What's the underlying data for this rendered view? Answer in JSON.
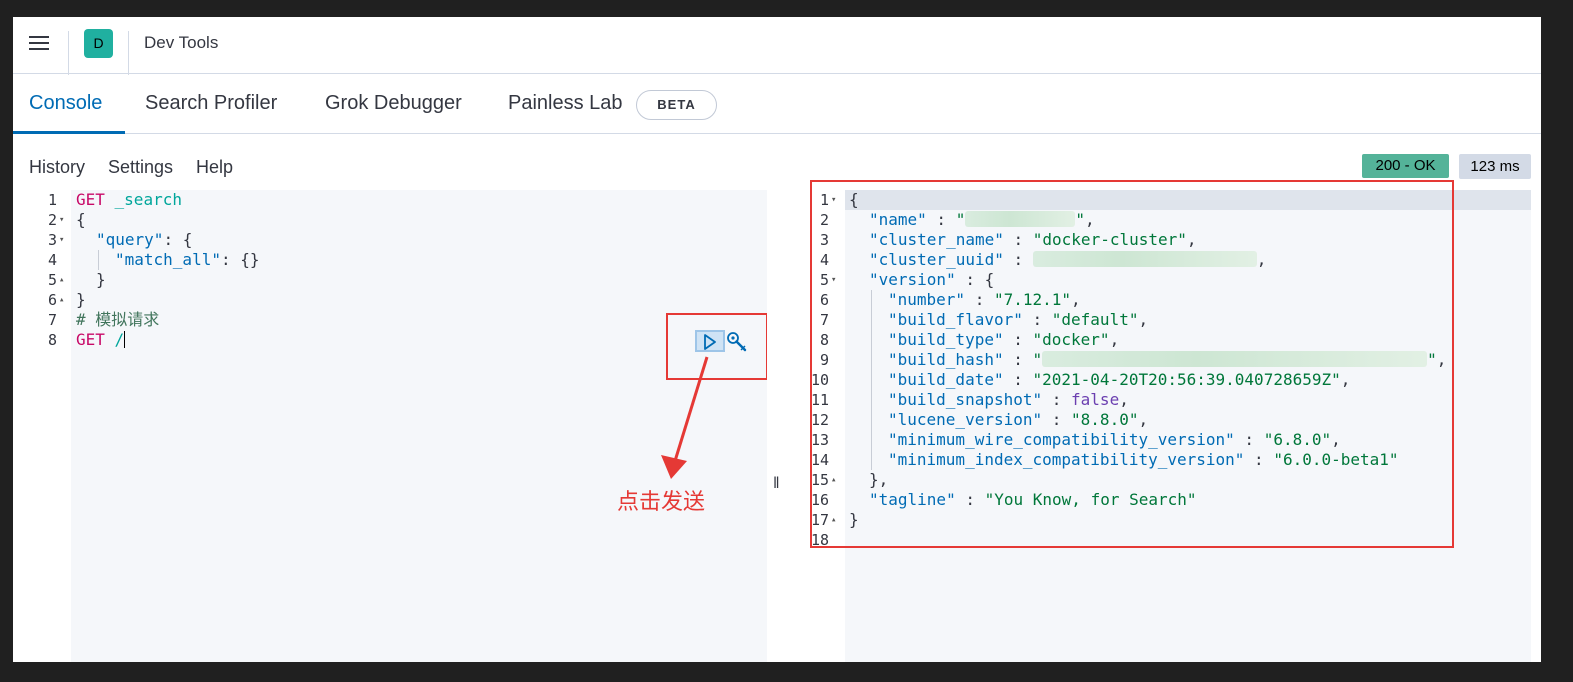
{
  "header": {
    "space_initial": "D",
    "app_title": "Dev Tools"
  },
  "tabs": [
    {
      "label": "Console",
      "active": true
    },
    {
      "label": "Search Profiler",
      "active": false
    },
    {
      "label": "Grok Debugger",
      "active": false
    },
    {
      "label": "Painless Lab",
      "active": false,
      "badge": "BETA"
    }
  ],
  "subnav": {
    "history": "History",
    "settings": "Settings",
    "help": "Help"
  },
  "status": {
    "code_text": "200 - OK",
    "time_text": "123 ms",
    "color": "#54b399"
  },
  "editor": {
    "lines": [
      {
        "n": "1",
        "fold": "",
        "method": "GET",
        "url": " _search"
      },
      {
        "n": "2",
        "fold": "▾",
        "text": "{"
      },
      {
        "n": "3",
        "fold": "▾",
        "key": "\"query\"",
        "rest": ": {"
      },
      {
        "n": "4",
        "fold": "",
        "key": "\"match_all\"",
        "rest": ": {}"
      },
      {
        "n": "5",
        "fold": "▴",
        "text": "}"
      },
      {
        "n": "6",
        "fold": "▴",
        "text": "}"
      },
      {
        "n": "7",
        "fold": "",
        "comment": "# 模拟请求"
      },
      {
        "n": "8",
        "fold": "",
        "method": "GET",
        "url": " /"
      }
    ],
    "actions": {
      "play": "play-icon",
      "wrench": "wrench-icon"
    }
  },
  "annotation": {
    "text": "点击发送",
    "color": "#e53935"
  },
  "output": {
    "lines": [
      {
        "n": "1",
        "fold": "▾"
      },
      {
        "n": "2",
        "fold": ""
      },
      {
        "n": "3",
        "fold": ""
      },
      {
        "n": "4",
        "fold": ""
      },
      {
        "n": "5",
        "fold": "▾"
      },
      {
        "n": "6",
        "fold": ""
      },
      {
        "n": "7",
        "fold": ""
      },
      {
        "n": "8",
        "fold": ""
      },
      {
        "n": "9",
        "fold": ""
      },
      {
        "n": "10",
        "fold": ""
      },
      {
        "n": "11",
        "fold": ""
      },
      {
        "n": "12",
        "fold": ""
      },
      {
        "n": "13",
        "fold": ""
      },
      {
        "n": "14",
        "fold": ""
      },
      {
        "n": "15",
        "fold": "▴"
      },
      {
        "n": "16",
        "fold": ""
      },
      {
        "n": "17",
        "fold": "▴"
      },
      {
        "n": "18",
        "fold": ""
      }
    ],
    "json": {
      "name_key": "\"name\"",
      "cluster_name_key": "\"cluster_name\"",
      "cluster_name_val": "\"docker-cluster\"",
      "cluster_uuid_key": "\"cluster_uuid\"",
      "version_key": "\"version\"",
      "number_key": "\"number\"",
      "number_val": "\"7.12.1\"",
      "build_flavor_key": "\"build_flavor\"",
      "build_flavor_val": "\"default\"",
      "build_type_key": "\"build_type\"",
      "build_type_val": "\"docker\"",
      "build_hash_key": "\"build_hash\"",
      "build_date_key": "\"build_date\"",
      "build_date_val": "\"2021-04-20T20:56:39.040728659Z\"",
      "build_snapshot_key": "\"build_snapshot\"",
      "build_snapshot_val": "false",
      "lucene_version_key": "\"lucene_version\"",
      "lucene_version_val": "\"8.8.0\"",
      "min_wire_key": "\"minimum_wire_compatibility_version\"",
      "min_wire_val": "\"6.8.0\"",
      "min_index_key": "\"minimum_index_compatibility_version\"",
      "min_index_val": "\"6.0.0-beta1\"",
      "tagline_key": "\"tagline\"",
      "tagline_val": "\"You Know, for Search\""
    }
  }
}
